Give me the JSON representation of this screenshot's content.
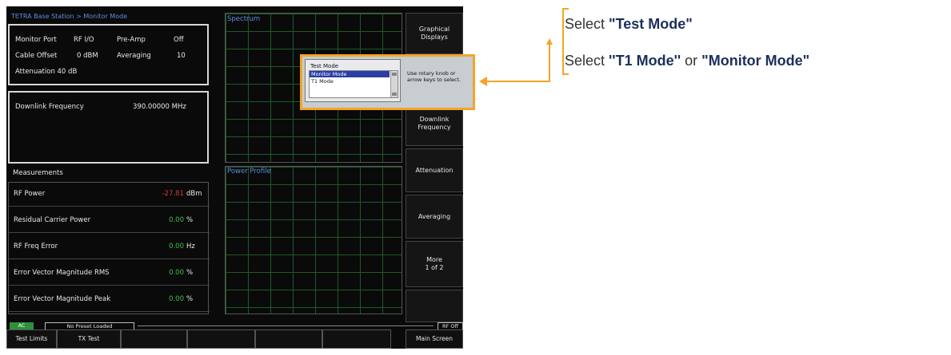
{
  "screen": {
    "title": "TETRA Base Station > Monitor Mode",
    "settings": {
      "monitor_port_label": "Monitor Port",
      "monitor_port_value": "RF I/O",
      "preamp_label": "Pre-Amp",
      "preamp_value": "Off",
      "cable_offset_label": "Cable Offset",
      "cable_offset_value": "0 dBM",
      "averaging_label": "Averaging",
      "averaging_value": "10",
      "attenuation_text": "Attenuation  40 dB"
    },
    "downlink": {
      "label": "Downlink Frequency",
      "value": "390.00000 MHz"
    },
    "measurements": {
      "title": "Measurements",
      "rows": [
        {
          "name": "RF Power",
          "value": "-27.81",
          "unit": "dBm",
          "color": "#d23b3b"
        },
        {
          "name": "Residual Carrier Power",
          "value": "0.00",
          "unit": "%",
          "color": "#3fbf4f"
        },
        {
          "name": "RF Freq Error",
          "value": "0.00",
          "unit": "Hz",
          "color": "#3fbf4f"
        },
        {
          "name": "Error Vector Magnitude RMS",
          "value": "0.00",
          "unit": "%",
          "color": "#3fbf4f"
        },
        {
          "name": "Error Vector Magnitude Peak",
          "value": "0.00",
          "unit": "%",
          "color": "#3fbf4f"
        }
      ]
    },
    "spectrum_title": "Spectrum",
    "power_profile_title": "Power Profile",
    "popup": {
      "title": "Test Mode",
      "options": [
        "Monitor Mode",
        "T1 Mode"
      ],
      "selected": "Monitor Mode",
      "hint": "Use rotary knob or arrow keys to select."
    },
    "softkeys": [
      "Graphical\nDisplays",
      "",
      "Downlink\nFrequency",
      "Attenuation",
      "Averaging",
      "More\n1 of 2",
      ""
    ],
    "status": {
      "ac": "AC",
      "preset": "No Preset Loaded",
      "rf": "RF Off"
    },
    "bottom_buttons": [
      "Test Limits",
      "TX Test",
      "",
      "",
      "",
      "",
      "Main Screen"
    ],
    "colors": {
      "accent": "#f5a425",
      "title_blue": "#5a8fe0",
      "selection": "#2a3ea8"
    }
  },
  "annotations": {
    "line1_prefix": "Select ",
    "line1_bold": "\"Test Mode\"",
    "line2_prefix": "Select ",
    "line2_bold1": "''T1 Mode''",
    "line2_mid": " or ",
    "line2_bold2": "\"Monitor Mode\""
  }
}
